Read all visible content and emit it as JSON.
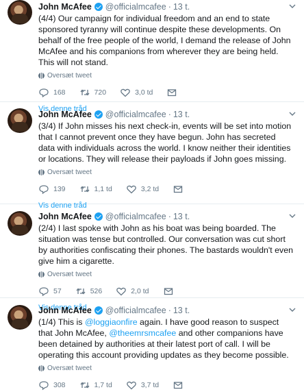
{
  "author": {
    "name": "John McAfee",
    "handle": "@officialmcafee",
    "time": "13 t."
  },
  "labels": {
    "translate": "Oversæt tweet",
    "show_thread": "Vis denne tråd"
  },
  "colors": {
    "accent": "#1da1f2",
    "muted": "#657786",
    "text": "#14171a",
    "divider": "#e6ecf0"
  },
  "tweets": [
    {
      "text": "(4/4) Our campaign for individual freedom and an end to state sponsored tyranny will continue despite these developments. On behalf of the free people of the world, I demand the release of John McAfee and his companions from wherever they are being held. This will not stand.",
      "replies": "168",
      "retweets": "720",
      "likes": "3,0 td"
    },
    {
      "text": "(3/4) If John misses his next check-in, events will be set into motion that I cannot prevent once they have begun.  John has secreted data with individuals across the world. I know neither their identities or locations. They will release their payloads if John goes missing.",
      "replies": "139",
      "retweets": "1,1 td",
      "likes": "3,2 td"
    },
    {
      "text": "(2/4) I last spoke with John as his boat was being boarded. The situation was tense but controlled. Our conversation was cut short by authorities confiscating their phones. The bastards wouldn't even give him a cigarette.",
      "replies": "57",
      "retweets": "526",
      "likes": "2,0 td"
    },
    {
      "text_parts": {
        "p1": "(1/4) This is ",
        "m1": "@loggiaonfire",
        "p2": " again. I have good reason to suspect that John McAfee, ",
        "m2": "@theemrsmcafee",
        "p3": " and other companions have been detained by authorities at their latest port of call. I will be operating this account providing updates as they become possible."
      },
      "replies": "308",
      "retweets": "1,7 td",
      "likes": "3,7 td"
    }
  ],
  "icons": {
    "verified": "verified-badge-icon",
    "chevron": "chevron-down-icon",
    "translate": "globe-icon",
    "reply": "reply-icon",
    "retweet": "retweet-icon",
    "like": "heart-icon",
    "dm": "envelope-icon"
  }
}
